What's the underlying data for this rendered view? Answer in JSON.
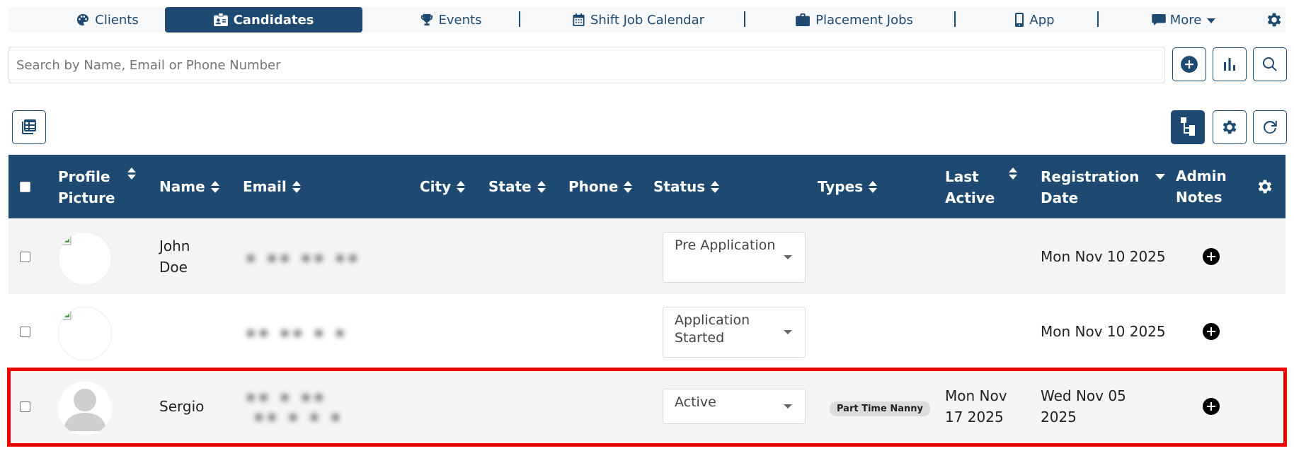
{
  "nav": {
    "items": [
      {
        "label": "Clients",
        "icon": "palette-icon"
      },
      {
        "label": "Candidates",
        "icon": "id-badge-icon",
        "active": true
      },
      {
        "label": "Events",
        "icon": "trophy-icon"
      },
      {
        "label": "Shift Job Calendar",
        "icon": "calendar-icon"
      },
      {
        "label": "Placement Jobs",
        "icon": "briefcase-icon"
      },
      {
        "label": "App",
        "icon": "phone-icon"
      },
      {
        "label": "More",
        "icon": "comment-icon"
      }
    ]
  },
  "search": {
    "placeholder": "Search by Name, Email or Phone Number"
  },
  "table": {
    "headers": {
      "profile_picture": "Profile Picture",
      "name": "Name",
      "email": "Email",
      "city": "City",
      "state": "State",
      "phone": "Phone",
      "status": "Status",
      "types": "Types",
      "last_active": "Last Active",
      "registration_date": "Registration Date",
      "admin_notes": "Admin Notes"
    },
    "rows": [
      {
        "name": "John Doe",
        "status": "Pre Application",
        "types": "",
        "last_active": "",
        "registration_date": "Mon Nov 10 2025"
      },
      {
        "name": "",
        "status": "Application Started",
        "types": "",
        "last_active": "",
        "registration_date": "Mon Nov 10 2025"
      },
      {
        "name": "Sergio",
        "status": "Active",
        "types": "Part Time Nanny",
        "last_active": "Mon Nov 17 2025",
        "registration_date": "Wed Nov 05 2025"
      }
    ]
  },
  "colors": {
    "primary": "#1e4a72",
    "highlight": "#ee0000",
    "row_alt": "#f4f5f7"
  }
}
